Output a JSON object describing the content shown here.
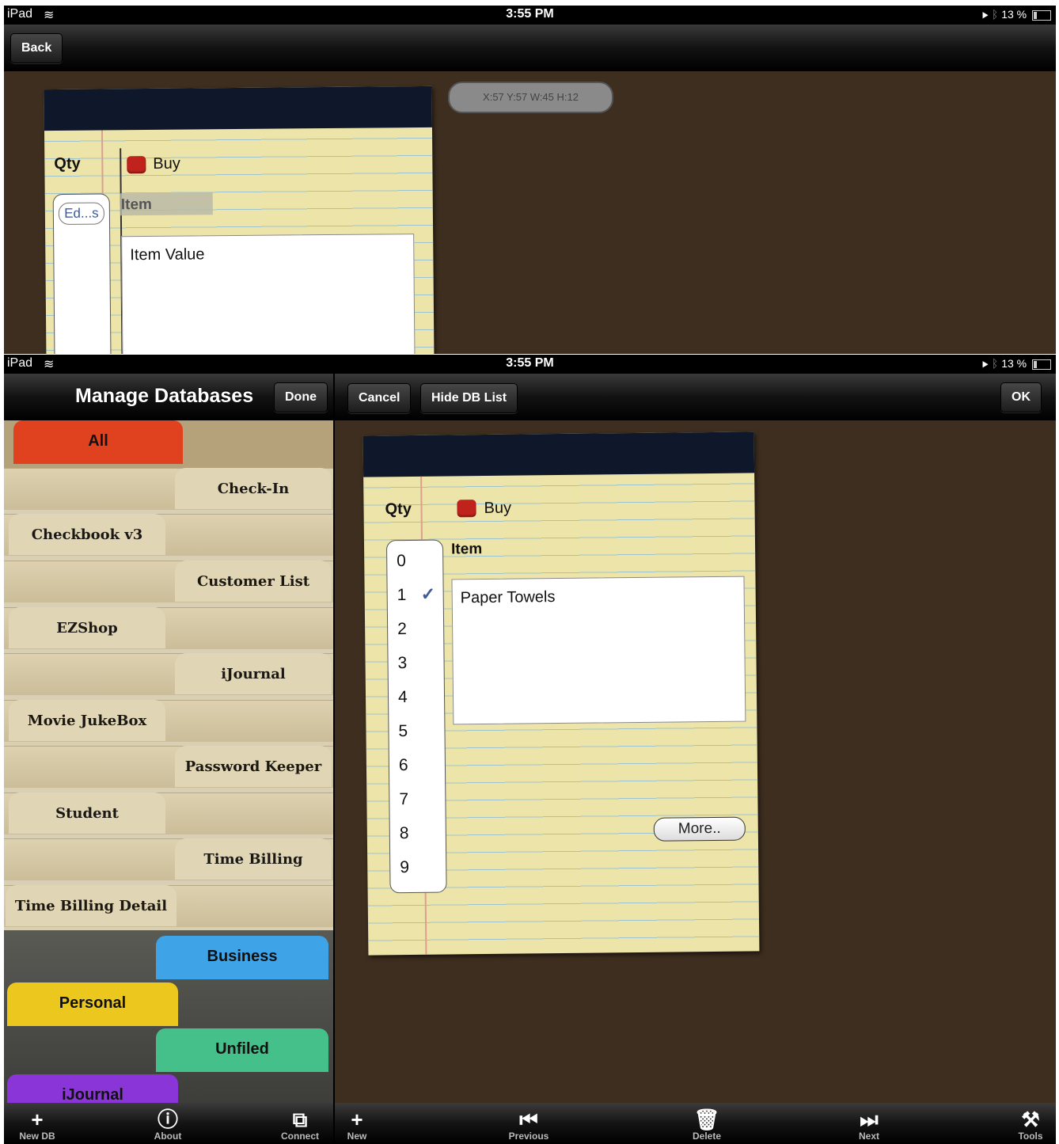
{
  "status": {
    "device": "iPad",
    "time": "3:55 PM",
    "battery": "13 %"
  },
  "top_screen": {
    "back_label": "Back",
    "coord_readout": "X:57 Y:57 W:45 H:12",
    "qty_label": "Qty",
    "buy_label": "Buy",
    "edit_chip": "Ed...s",
    "item_label": "Item",
    "item_value": "Item Value"
  },
  "bottom_screen": {
    "manage_title": "Manage Databases",
    "done_label": "Done",
    "cancel_label": "Cancel",
    "hide_db_label": "Hide DB List",
    "ok_label": "OK",
    "qty_label": "Qty",
    "buy_label": "Buy",
    "item_label": "Item",
    "item_value": "Paper Towels",
    "more_label": "More..",
    "qty_options": [
      "0",
      "1",
      "2",
      "3",
      "4",
      "5",
      "6",
      "7",
      "8",
      "9"
    ],
    "selected_qty": "1",
    "databases": [
      "Check-In",
      "Checkbook v3",
      "Customer List",
      "EZShop",
      "iJournal",
      "Movie JukeBox",
      "Password Keeper",
      "Student",
      "Time Billing",
      "Time Billing Detail"
    ],
    "categories": [
      {
        "label": "All",
        "color": "#e0411f"
      },
      {
        "label": "Business",
        "color": "#3fa3e8"
      },
      {
        "label": "Personal",
        "color": "#ecc81e"
      },
      {
        "label": "Unfiled",
        "color": "#46c08a"
      },
      {
        "label": "iJournal",
        "color": "#8a35d8"
      }
    ],
    "left_toolbar": [
      {
        "label": "New DB",
        "icon": "plus-icon"
      },
      {
        "label": "About",
        "icon": "info-icon"
      },
      {
        "label": "Connect",
        "icon": "connect-icon"
      }
    ],
    "right_toolbar": [
      {
        "label": "New",
        "icon": "plus-icon"
      },
      {
        "label": "Previous",
        "icon": "previous-icon"
      },
      {
        "label": "Delete",
        "icon": "trash-icon"
      },
      {
        "label": "Next",
        "icon": "next-icon"
      },
      {
        "label": "Tools",
        "icon": "tools-icon"
      }
    ]
  }
}
